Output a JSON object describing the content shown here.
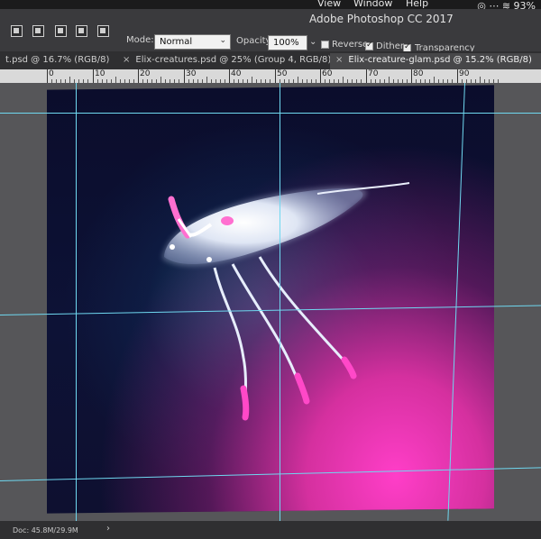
{
  "menubar": {
    "items": [
      "View",
      "Window",
      "Help"
    ],
    "battery": "93%"
  },
  "app": {
    "title": "Adobe Photoshop CC 2017"
  },
  "options": {
    "mode_label": "Mode:",
    "mode_value": "Normal",
    "opacity_label": "Opacity:",
    "opacity_value": "100%",
    "reverse_label": "Reverse",
    "reverse_checked": false,
    "dither_label": "Dither",
    "dither_checked": true,
    "transparency_label": "Transparency",
    "transparency_checked": true
  },
  "tabs": [
    {
      "label": "t.psd @ 16.7% (RGB/8)",
      "active": false
    },
    {
      "label": "Elix-creatures.psd @ 25% (Group 4, RGB/8) *",
      "active": false
    },
    {
      "label": "Elix-creature-glam.psd @ 15.2% (RGB/8)",
      "active": true
    }
  ],
  "ruler": {
    "labels": [
      "0",
      "10",
      "20",
      "30",
      "40",
      "50",
      "60",
      "70",
      "80",
      "90"
    ]
  },
  "status": {
    "doc": "Doc: 45.8M/29.9M"
  },
  "colors": {
    "guide": "#6fd8f0",
    "canvas_dark": "#0b0d2c",
    "glow_pink": "#ff3ec8"
  }
}
